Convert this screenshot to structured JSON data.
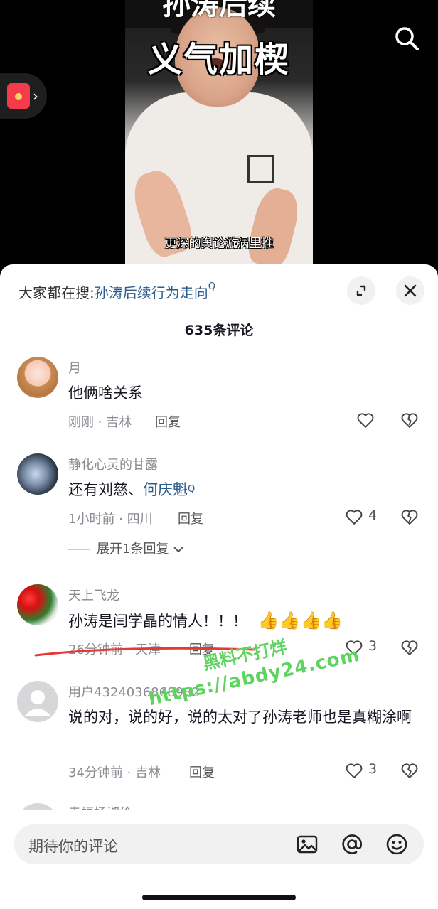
{
  "video": {
    "overlay_top": "孙涛后续",
    "overlay_title": "义气加楔",
    "subtitle": "更深的舆论漩涡里推"
  },
  "sheet": {
    "hot_search_prefix": "大家都在搜:",
    "hot_search_keyword": "孙涛后续行为走向",
    "comment_count": "635条评论"
  },
  "comments": [
    {
      "username": "月",
      "text": "他俩啥关系",
      "time_location": "刚刚 · 吉林",
      "reply_label": "回复",
      "likes": ""
    },
    {
      "username": "静化心灵的甘露",
      "text_prefix": "还有刘慈、",
      "text_link": "何庆魁",
      "time_location": "1小时前 · 四川",
      "reply_label": "回复",
      "likes": "4",
      "expand_replies": "展开1条回复"
    },
    {
      "username": "天上飞龙",
      "text": "孙涛是闫学晶的情人！！！",
      "emoji": "👍👍👍👍",
      "time_location": "26分钟前 · 天津",
      "reply_label": "回复",
      "likes": "3"
    },
    {
      "username": "用户4324036868982",
      "text": "说的对，说的好，说的太对了孙涛老师也是真糊涂啊",
      "time_location": "34分钟前 · 吉林",
      "reply_label": "回复",
      "likes": "3"
    },
    {
      "username": "幸福杨淑伶"
    }
  ],
  "watermark": {
    "line1": "黑料不打烊",
    "line2": "https://abdy24.com"
  },
  "input": {
    "placeholder": "期待你的评论"
  },
  "colors": {
    "link": "#2b5d8c",
    "text": "#161823",
    "muted": "#8a8b91",
    "watermark": "#5fd35f",
    "annotation": "#e53935"
  },
  "icons": [
    "search-icon",
    "red-envelope-icon",
    "expand-icon",
    "close-icon",
    "heart-icon",
    "dislike-heart-icon",
    "image-icon",
    "at-icon",
    "emoji-icon"
  ]
}
